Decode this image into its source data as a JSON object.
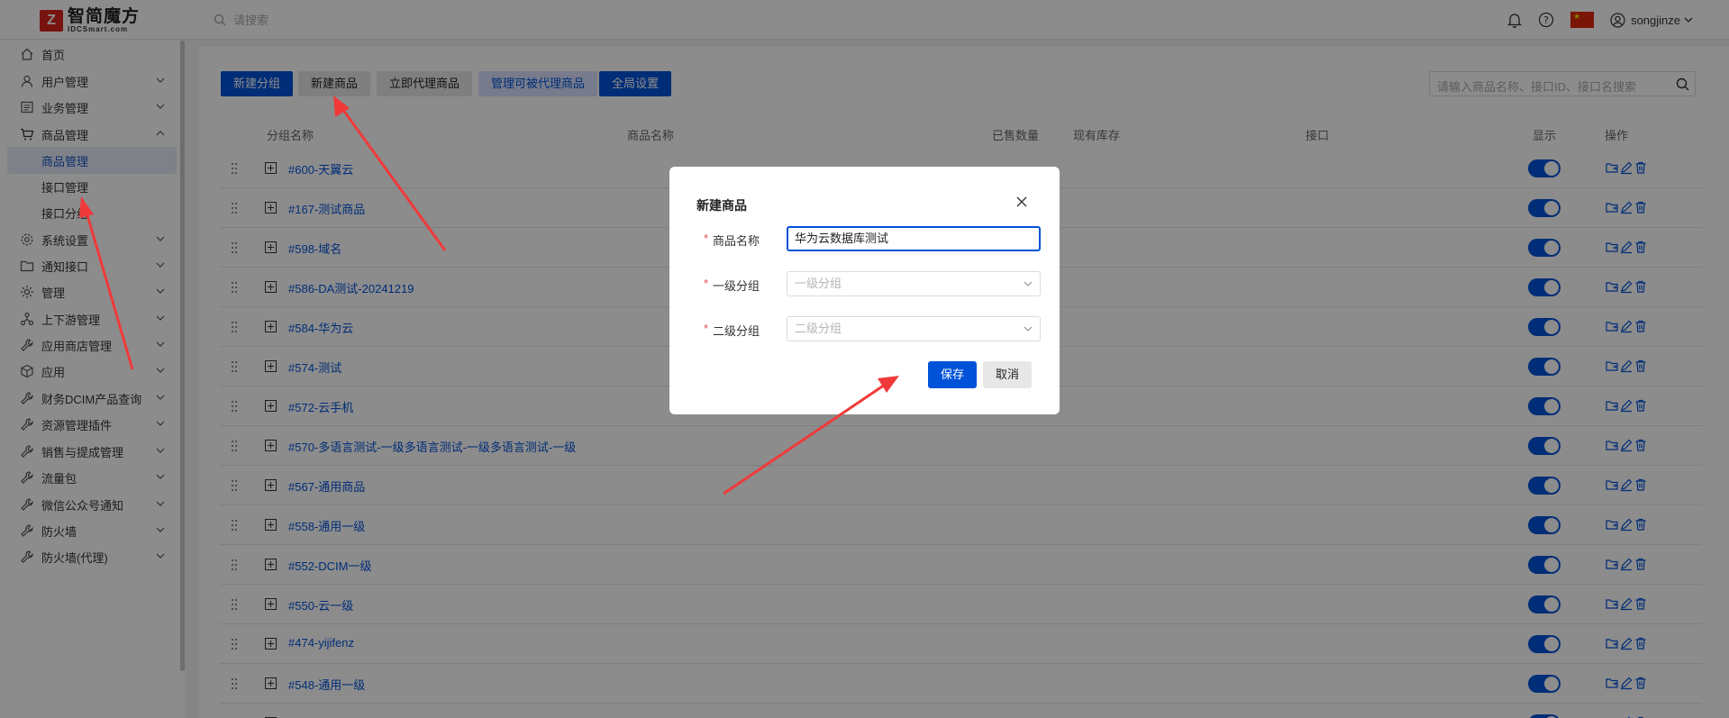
{
  "logo": {
    "text_cn": "智简魔方",
    "text_en": "IDCSmart.com",
    "mark": "Z"
  },
  "topbar": {
    "search_placeholder": "请搜索",
    "username": "songjinze",
    "icons": [
      "bell-icon",
      "help-icon",
      "flag-cn-icon",
      "user-icon"
    ]
  },
  "sidebar": {
    "items": [
      {
        "label": "首页",
        "icon": "home-icon",
        "expandable": false
      },
      {
        "label": "用户管理",
        "icon": "user-icon",
        "expandable": true
      },
      {
        "label": "业务管理",
        "icon": "list-icon",
        "expandable": true
      },
      {
        "label": "商品管理",
        "icon": "cart-icon",
        "expandable": true,
        "expanded": true
      },
      {
        "label": "商品管理",
        "sub": true,
        "active": true
      },
      {
        "label": "接口管理",
        "sub": true
      },
      {
        "label": "接口分组",
        "sub": true
      },
      {
        "label": "系统设置",
        "icon": "settings-icon",
        "expandable": true
      },
      {
        "label": "通知接口",
        "icon": "folder-icon",
        "expandable": true
      },
      {
        "label": "管理",
        "icon": "sun-icon",
        "expandable": true
      },
      {
        "label": "上下游管理",
        "icon": "network-icon",
        "expandable": true
      },
      {
        "label": "应用商店管理",
        "icon": "wrench-icon",
        "expandable": true
      },
      {
        "label": "应用",
        "icon": "cube-icon",
        "expandable": true
      },
      {
        "label": "财务DCIM产品查询",
        "icon": "wrench-icon",
        "expandable": true
      },
      {
        "label": "资源管理插件",
        "icon": "wrench-icon",
        "expandable": true
      },
      {
        "label": "销售与提成管理",
        "icon": "wrench-icon",
        "expandable": true
      },
      {
        "label": "流量包",
        "icon": "wrench-icon",
        "expandable": true
      },
      {
        "label": "微信公众号通知",
        "icon": "wrench-icon",
        "expandable": true
      },
      {
        "label": "防火墙",
        "icon": "wrench-icon",
        "expandable": true
      },
      {
        "label": "防火墙(代理)",
        "icon": "wrench-icon",
        "expandable": true
      }
    ]
  },
  "toolbar": {
    "new_group": "新建分组",
    "new_product": "新建商品",
    "agent_product": "立即代理商品",
    "manage_agentable": "管理可被代理商品",
    "global_settings": "全局设置",
    "search_placeholder": "请输入商品名称、接口ID、接口名搜索"
  },
  "table": {
    "headers": {
      "group_name": "分组名称",
      "product_name": "商品名称",
      "sold": "已售数量",
      "stock": "现有库存",
      "interface": "接口",
      "display": "显示",
      "actions": "操作"
    },
    "rows": [
      {
        "group": "#600-天翼云",
        "display": true
      },
      {
        "group": "#167-测试商品",
        "display": true
      },
      {
        "group": "#598-域名",
        "display": true
      },
      {
        "group": "#586-DA测试-20241219",
        "display": true
      },
      {
        "group": "#584-华为云",
        "display": true
      },
      {
        "group": "#574-测试",
        "display": true
      },
      {
        "group": "#572-云手机",
        "display": true
      },
      {
        "group": "#570-多语言测试-一级多语言测试-一级多语言测试-一级",
        "display": true
      },
      {
        "group": "#567-通用商品",
        "display": true
      },
      {
        "group": "#558-通用一级",
        "display": true
      },
      {
        "group": "#552-DCIM一级",
        "display": true
      },
      {
        "group": "#550-云一级",
        "display": true
      },
      {
        "group": "#474-yijifenz",
        "display": true
      },
      {
        "group": "#548-通用一级",
        "display": true
      },
      {
        "group": "",
        "display": true
      }
    ]
  },
  "dialog": {
    "title": "新建商品",
    "fields": {
      "product_name": {
        "label": "商品名称",
        "value": "华为云数据库测试"
      },
      "level1_group": {
        "label": "一级分组",
        "placeholder": "一级分组"
      },
      "level2_group": {
        "label": "二级分组",
        "placeholder": "二级分组"
      }
    },
    "required_mark": "*",
    "save": "保存",
    "cancel": "取消"
  },
  "colors": {
    "primary": "#0052d9",
    "brand_red": "#d9261c",
    "annotation_arrow": "#f03a3a",
    "required": "#e34d59"
  }
}
